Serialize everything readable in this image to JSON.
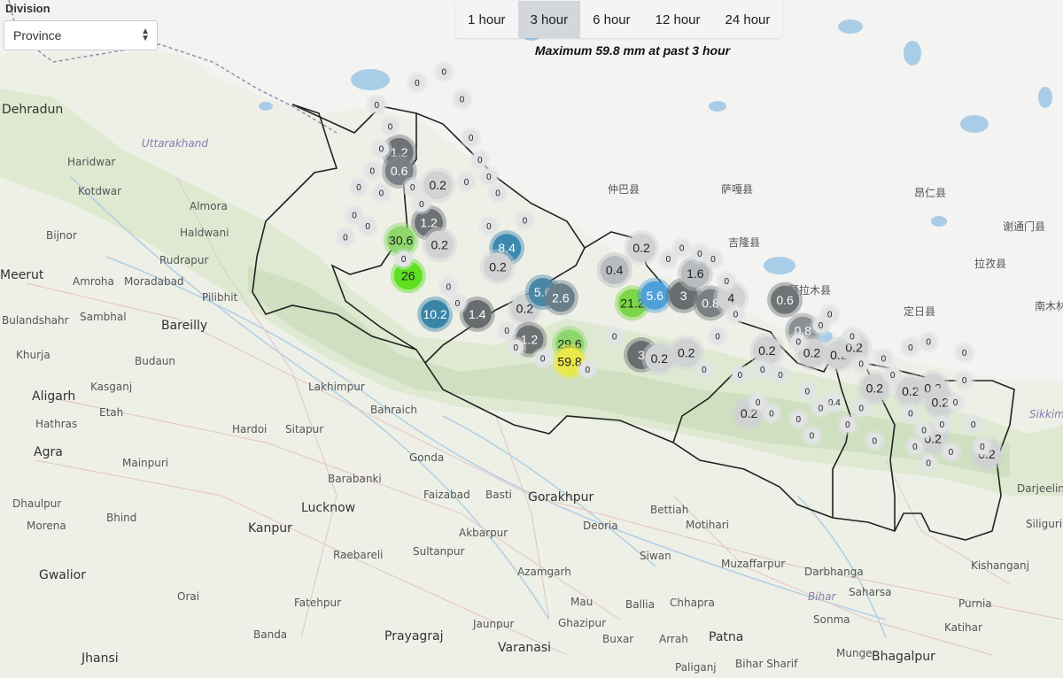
{
  "division": {
    "label": "Division",
    "selected": "Province"
  },
  "tabs": [
    {
      "label": "1 hour",
      "active": false
    },
    {
      "label": "3 hour",
      "active": true
    },
    {
      "label": "6 hour",
      "active": false
    },
    {
      "label": "12 hour",
      "active": false
    },
    {
      "label": "24 hour",
      "active": false
    }
  ],
  "summary": "Maximum 59.8 mm at past 3 hour",
  "map": {
    "cities": [
      {
        "name": "Dehradun",
        "big": true
      },
      {
        "name": "Haridwar"
      },
      {
        "name": "Kotdwar"
      },
      {
        "name": "Almora"
      },
      {
        "name": "Haldwani"
      },
      {
        "name": "Bijnor"
      },
      {
        "name": "Rudrapur"
      },
      {
        "name": "Meerut",
        "big": true
      },
      {
        "name": "Amroha"
      },
      {
        "name": "Moradabad"
      },
      {
        "name": "Pilibhit"
      },
      {
        "name": "Sambhal"
      },
      {
        "name": "Bareilly",
        "big": true
      },
      {
        "name": "Bulandshahr"
      },
      {
        "name": "Khurja"
      },
      {
        "name": "Budaun"
      },
      {
        "name": "Aligarh",
        "big": true
      },
      {
        "name": "Kasganj"
      },
      {
        "name": "Etah"
      },
      {
        "name": "Hathras"
      },
      {
        "name": "Agra",
        "big": true
      },
      {
        "name": "Mainpuri"
      },
      {
        "name": "Hardoi"
      },
      {
        "name": "Sitapur"
      },
      {
        "name": "Lakhimpur"
      },
      {
        "name": "Bahraich"
      },
      {
        "name": "Gonda"
      },
      {
        "name": "Barabanki"
      },
      {
        "name": "Lucknow",
        "big": true
      },
      {
        "name": "Faizabad"
      },
      {
        "name": "Basti"
      },
      {
        "name": "Gorakhpur",
        "big": true
      },
      {
        "name": "Kanpur",
        "big": true
      },
      {
        "name": "Dhaulpur"
      },
      {
        "name": "Bhind"
      },
      {
        "name": "Morena"
      },
      {
        "name": "Gwalior",
        "big": true
      },
      {
        "name": "Orai"
      },
      {
        "name": "Raebareli"
      },
      {
        "name": "Sultanpur"
      },
      {
        "name": "Akbarpur"
      },
      {
        "name": "Azamgarh"
      },
      {
        "name": "Deoria"
      },
      {
        "name": "Bettiah"
      },
      {
        "name": "Motihari"
      },
      {
        "name": "Siwan"
      },
      {
        "name": "Muzaffarpur"
      },
      {
        "name": "Darbhanga"
      },
      {
        "name": "Fatehpur"
      },
      {
        "name": "Banda"
      },
      {
        "name": "Prayagraj",
        "big": true
      },
      {
        "name": "Jaunpur"
      },
      {
        "name": "Mau"
      },
      {
        "name": "Ballia"
      },
      {
        "name": "Chhapra"
      },
      {
        "name": "Ghazipur"
      },
      {
        "name": "Varanasi",
        "big": true
      },
      {
        "name": "Buxar"
      },
      {
        "name": "Arrah"
      },
      {
        "name": "Patna",
        "big": true
      },
      {
        "name": "Saharsa"
      },
      {
        "name": "Sonma"
      },
      {
        "name": "Purnia"
      },
      {
        "name": "Katihar"
      },
      {
        "name": "Kishanganj"
      },
      {
        "name": "Siliguri"
      },
      {
        "name": "Darjeeling"
      },
      {
        "name": "Munger"
      },
      {
        "name": "Bhagalpur",
        "big": true
      },
      {
        "name": "Bihar Sharif"
      },
      {
        "name": "Paliganj"
      },
      {
        "name": "Jhansi",
        "big": true
      }
    ],
    "regions": [
      {
        "name": "Uttarakhand"
      },
      {
        "name": "Bihar"
      },
      {
        "name": "Sikkim"
      }
    ],
    "tibet_labels": [
      "仲巴县",
      "萨嘎县",
      "吉隆县",
      "聂拉木县",
      "定日县",
      "拉孜县",
      "昂仁县",
      "谢通门县",
      "南木林县"
    ],
    "stations": [
      {
        "v": "1.2",
        "lon": 81.55,
        "lat": 29.72,
        "c": "#6f7275",
        "big": true
      },
      {
        "v": "0.6",
        "lon": 81.55,
        "lat": 29.55,
        "c": "#7c8085",
        "big": true
      },
      {
        "v": "0.2",
        "lon": 81.98,
        "lat": 29.42,
        "c": "#d0d2d4",
        "big": true
      },
      {
        "v": "1.2",
        "lon": 81.88,
        "lat": 29.08,
        "c": "#6f7275",
        "big": true
      },
      {
        "v": "0.2",
        "lon": 82.0,
        "lat": 28.88,
        "c": "#d0d2d4",
        "big": true
      },
      {
        "v": "30.6",
        "lon": 81.57,
        "lat": 28.92,
        "c": "#8fd66d",
        "big": true
      },
      {
        "v": "26",
        "lon": 81.65,
        "lat": 28.6,
        "c": "#5ee021",
        "big": true
      },
      {
        "v": "10.2",
        "lon": 81.95,
        "lat": 28.25,
        "c": "#3a84a8",
        "big": true
      },
      {
        "v": "8.4",
        "lon": 82.75,
        "lat": 28.85,
        "c": "#3c88ae",
        "big": true
      },
      {
        "v": "0.2",
        "lon": 82.65,
        "lat": 28.68,
        "c": "#d0d2d4",
        "big": true
      },
      {
        "v": "0.2",
        "lon": 82.95,
        "lat": 28.3,
        "c": "#d0d2d4",
        "big": true
      },
      {
        "v": "1.4",
        "lon": 82.42,
        "lat": 28.25,
        "c": "#6a6d70",
        "big": true
      },
      {
        "v": "5.6",
        "lon": 83.15,
        "lat": 28.45,
        "c": "#4a87a4",
        "big": true
      },
      {
        "v": "2.6",
        "lon": 83.35,
        "lat": 28.4,
        "c": "#6a7f8a",
        "big": true
      },
      {
        "v": "1.2",
        "lon": 83.0,
        "lat": 28.02,
        "c": "#6f7275",
        "big": true
      },
      {
        "v": "29.6",
        "lon": 83.45,
        "lat": 27.98,
        "c": "#8fd66d",
        "big": true
      },
      {
        "v": "59.8",
        "lon": 83.45,
        "lat": 27.82,
        "c": "#e8e84a",
        "big": true
      },
      {
        "v": "0.2",
        "lon": 84.25,
        "lat": 28.85,
        "c": "#d0d2d4",
        "big": true
      },
      {
        "v": "0.4",
        "lon": 83.95,
        "lat": 28.65,
        "c": "#b9bcbf",
        "big": true
      },
      {
        "v": "21.2",
        "lon": 84.15,
        "lat": 28.35,
        "c": "#7cd648",
        "big": true
      },
      {
        "v": "5.6",
        "lon": 84.4,
        "lat": 28.42,
        "c": "#4fa0d8",
        "big": true
      },
      {
        "v": "3",
        "lon": 84.72,
        "lat": 28.42,
        "c": "#6a6d70",
        "big": true
      },
      {
        "v": "0.8",
        "lon": 85.02,
        "lat": 28.35,
        "c": "#7c8085",
        "big": true
      },
      {
        "v": "1.6",
        "lon": 84.85,
        "lat": 28.62,
        "c": "#b9bcbf",
        "big": true
      },
      {
        "v": "4",
        "lon": 85.25,
        "lat": 28.4,
        "c": "#d0d2d4",
        "big": true
      },
      {
        "v": "0.6",
        "lon": 85.85,
        "lat": 28.38,
        "c": "#707376",
        "big": true
      },
      {
        "v": "0.8",
        "lon": 86.05,
        "lat": 28.1,
        "c": "#8c9094",
        "big": true
      },
      {
        "v": "3",
        "lon": 84.25,
        "lat": 27.88,
        "c": "#6a6d70",
        "big": true
      },
      {
        "v": "0.2",
        "lon": 84.45,
        "lat": 27.85,
        "c": "#d0d2d4",
        "big": true
      },
      {
        "v": "0.2",
        "lon": 84.75,
        "lat": 27.9,
        "c": "#d0d2d4",
        "big": true
      },
      {
        "v": "0.2",
        "lon": 85.65,
        "lat": 27.92,
        "c": "#d0d2d4",
        "big": true
      },
      {
        "v": "0.2",
        "lon": 86.15,
        "lat": 27.9,
        "c": "#d0d2d4",
        "big": true
      },
      {
        "v": "0.2",
        "lon": 86.45,
        "lat": 27.88,
        "c": "#d0d2d4",
        "big": true
      },
      {
        "v": "0.2",
        "lon": 86.62,
        "lat": 27.95,
        "c": "#d0d2d4",
        "big": true
      },
      {
        "v": "0.2",
        "lon": 86.85,
        "lat": 27.58,
        "c": "#d0d2d4",
        "big": true
      },
      {
        "v": "0.2",
        "lon": 87.25,
        "lat": 27.55,
        "c": "#d0d2d4",
        "big": true
      },
      {
        "v": "0.2",
        "lon": 87.5,
        "lat": 27.58,
        "c": "#d0d2d4",
        "big": true
      },
      {
        "v": "0.2",
        "lon": 87.58,
        "lat": 27.45,
        "c": "#d0d2d4",
        "big": true
      },
      {
        "v": "0.2",
        "lon": 85.45,
        "lat": 27.35,
        "c": "#d0d2d4",
        "big": true
      },
      {
        "v": "0.2",
        "lon": 87.5,
        "lat": 27.12,
        "c": "#d0d2d4",
        "big": true
      },
      {
        "v": "0.2",
        "lon": 88.1,
        "lat": 26.98,
        "c": "#d0d2d4",
        "big": true
      },
      {
        "v": "0.4",
        "lon": 86.4,
        "lat": 27.45,
        "c": "#e2e4e6",
        "big": false
      },
      {
        "v": "0",
        "lon": 81.1,
        "lat": 29.4
      },
      {
        "v": "0",
        "lon": 81.25,
        "lat": 29.55
      },
      {
        "v": "0",
        "lon": 81.35,
        "lat": 29.35
      },
      {
        "v": "0",
        "lon": 81.05,
        "lat": 29.15
      },
      {
        "v": "0",
        "lon": 81.2,
        "lat": 29.05
      },
      {
        "v": "0",
        "lon": 80.95,
        "lat": 28.95
      },
      {
        "v": "0",
        "lon": 81.35,
        "lat": 29.75
      },
      {
        "v": "0",
        "lon": 81.45,
        "lat": 29.95
      },
      {
        "v": "0",
        "lon": 81.3,
        "lat": 30.15
      },
      {
        "v": "0",
        "lon": 81.75,
        "lat": 30.35
      },
      {
        "v": "0",
        "lon": 82.05,
        "lat": 30.45
      },
      {
        "v": "0",
        "lon": 82.25,
        "lat": 30.2
      },
      {
        "v": "0",
        "lon": 82.35,
        "lat": 29.85
      },
      {
        "v": "0",
        "lon": 82.45,
        "lat": 29.65
      },
      {
        "v": "0",
        "lon": 82.55,
        "lat": 29.5
      },
      {
        "v": "0",
        "lon": 82.3,
        "lat": 29.45
      },
      {
        "v": "0",
        "lon": 82.65,
        "lat": 29.35
      },
      {
        "v": "0",
        "lon": 82.55,
        "lat": 29.05
      },
      {
        "v": "0",
        "lon": 82.95,
        "lat": 29.1
      },
      {
        "v": "0",
        "lon": 81.8,
        "lat": 29.25
      },
      {
        "v": "0",
        "lon": 81.7,
        "lat": 29.4
      },
      {
        "v": "0",
        "lon": 81.6,
        "lat": 28.75
      },
      {
        "v": "0",
        "lon": 82.2,
        "lat": 28.35
      },
      {
        "v": "0",
        "lon": 82.1,
        "lat": 28.5
      },
      {
        "v": "0",
        "lon": 82.75,
        "lat": 28.1
      },
      {
        "v": "0",
        "lon": 82.85,
        "lat": 27.95
      },
      {
        "v": "0",
        "lon": 83.15,
        "lat": 27.85
      },
      {
        "v": "0",
        "lon": 83.65,
        "lat": 27.75
      },
      {
        "v": "0",
        "lon": 83.95,
        "lat": 28.05
      },
      {
        "v": "0",
        "lon": 84.55,
        "lat": 28.75
      },
      {
        "v": "0",
        "lon": 84.7,
        "lat": 28.85
      },
      {
        "v": "0",
        "lon": 84.9,
        "lat": 28.8
      },
      {
        "v": "0",
        "lon": 85.05,
        "lat": 28.75
      },
      {
        "v": "0",
        "lon": 85.2,
        "lat": 28.55
      },
      {
        "v": "0",
        "lon": 85.3,
        "lat": 28.25
      },
      {
        "v": "0",
        "lon": 85.1,
        "lat": 28.05
      },
      {
        "v": "0",
        "lon": 84.95,
        "lat": 27.75
      },
      {
        "v": "0",
        "lon": 85.35,
        "lat": 27.7
      },
      {
        "v": "0",
        "lon": 85.6,
        "lat": 27.75
      },
      {
        "v": "0",
        "lon": 85.8,
        "lat": 27.7
      },
      {
        "v": "0",
        "lon": 86.0,
        "lat": 28.0
      },
      {
        "v": "0",
        "lon": 86.25,
        "lat": 28.15
      },
      {
        "v": "0",
        "lon": 86.35,
        "lat": 28.25
      },
      {
        "v": "0",
        "lon": 86.1,
        "lat": 27.55
      },
      {
        "v": "0",
        "lon": 86.25,
        "lat": 27.4
      },
      {
        "v": "0",
        "lon": 86.55,
        "lat": 27.25
      },
      {
        "v": "0",
        "lon": 86.7,
        "lat": 27.4
      },
      {
        "v": "0",
        "lon": 86.95,
        "lat": 27.85
      },
      {
        "v": "0",
        "lon": 87.05,
        "lat": 27.7
      },
      {
        "v": "0",
        "lon": 87.25,
        "lat": 27.35
      },
      {
        "v": "0",
        "lon": 87.4,
        "lat": 27.2
      },
      {
        "v": "0",
        "lon": 87.6,
        "lat": 27.25
      },
      {
        "v": "0",
        "lon": 87.75,
        "lat": 27.45
      },
      {
        "v": "0",
        "lon": 87.85,
        "lat": 27.65
      },
      {
        "v": "0",
        "lon": 87.95,
        "lat": 27.25
      },
      {
        "v": "0",
        "lon": 88.05,
        "lat": 27.05
      },
      {
        "v": "0",
        "lon": 87.7,
        "lat": 27.0
      },
      {
        "v": "0",
        "lon": 87.45,
        "lat": 26.9
      },
      {
        "v": "0",
        "lon": 87.3,
        "lat": 27.05
      },
      {
        "v": "0",
        "lon": 86.85,
        "lat": 27.1
      },
      {
        "v": "0",
        "lon": 87.25,
        "lat": 27.95
      },
      {
        "v": "0",
        "lon": 87.45,
        "lat": 28.0
      },
      {
        "v": "0",
        "lon": 87.85,
        "lat": 27.9
      },
      {
        "v": "0",
        "lon": 86.6,
        "lat": 28.05
      },
      {
        "v": "0",
        "lon": 86.7,
        "lat": 27.8
      },
      {
        "v": "0",
        "lon": 85.55,
        "lat": 27.45
      },
      {
        "v": "0",
        "lon": 85.7,
        "lat": 27.35
      },
      {
        "v": "0",
        "lon": 86.0,
        "lat": 27.3
      },
      {
        "v": "0",
        "lon": 86.15,
        "lat": 27.15
      }
    ]
  }
}
